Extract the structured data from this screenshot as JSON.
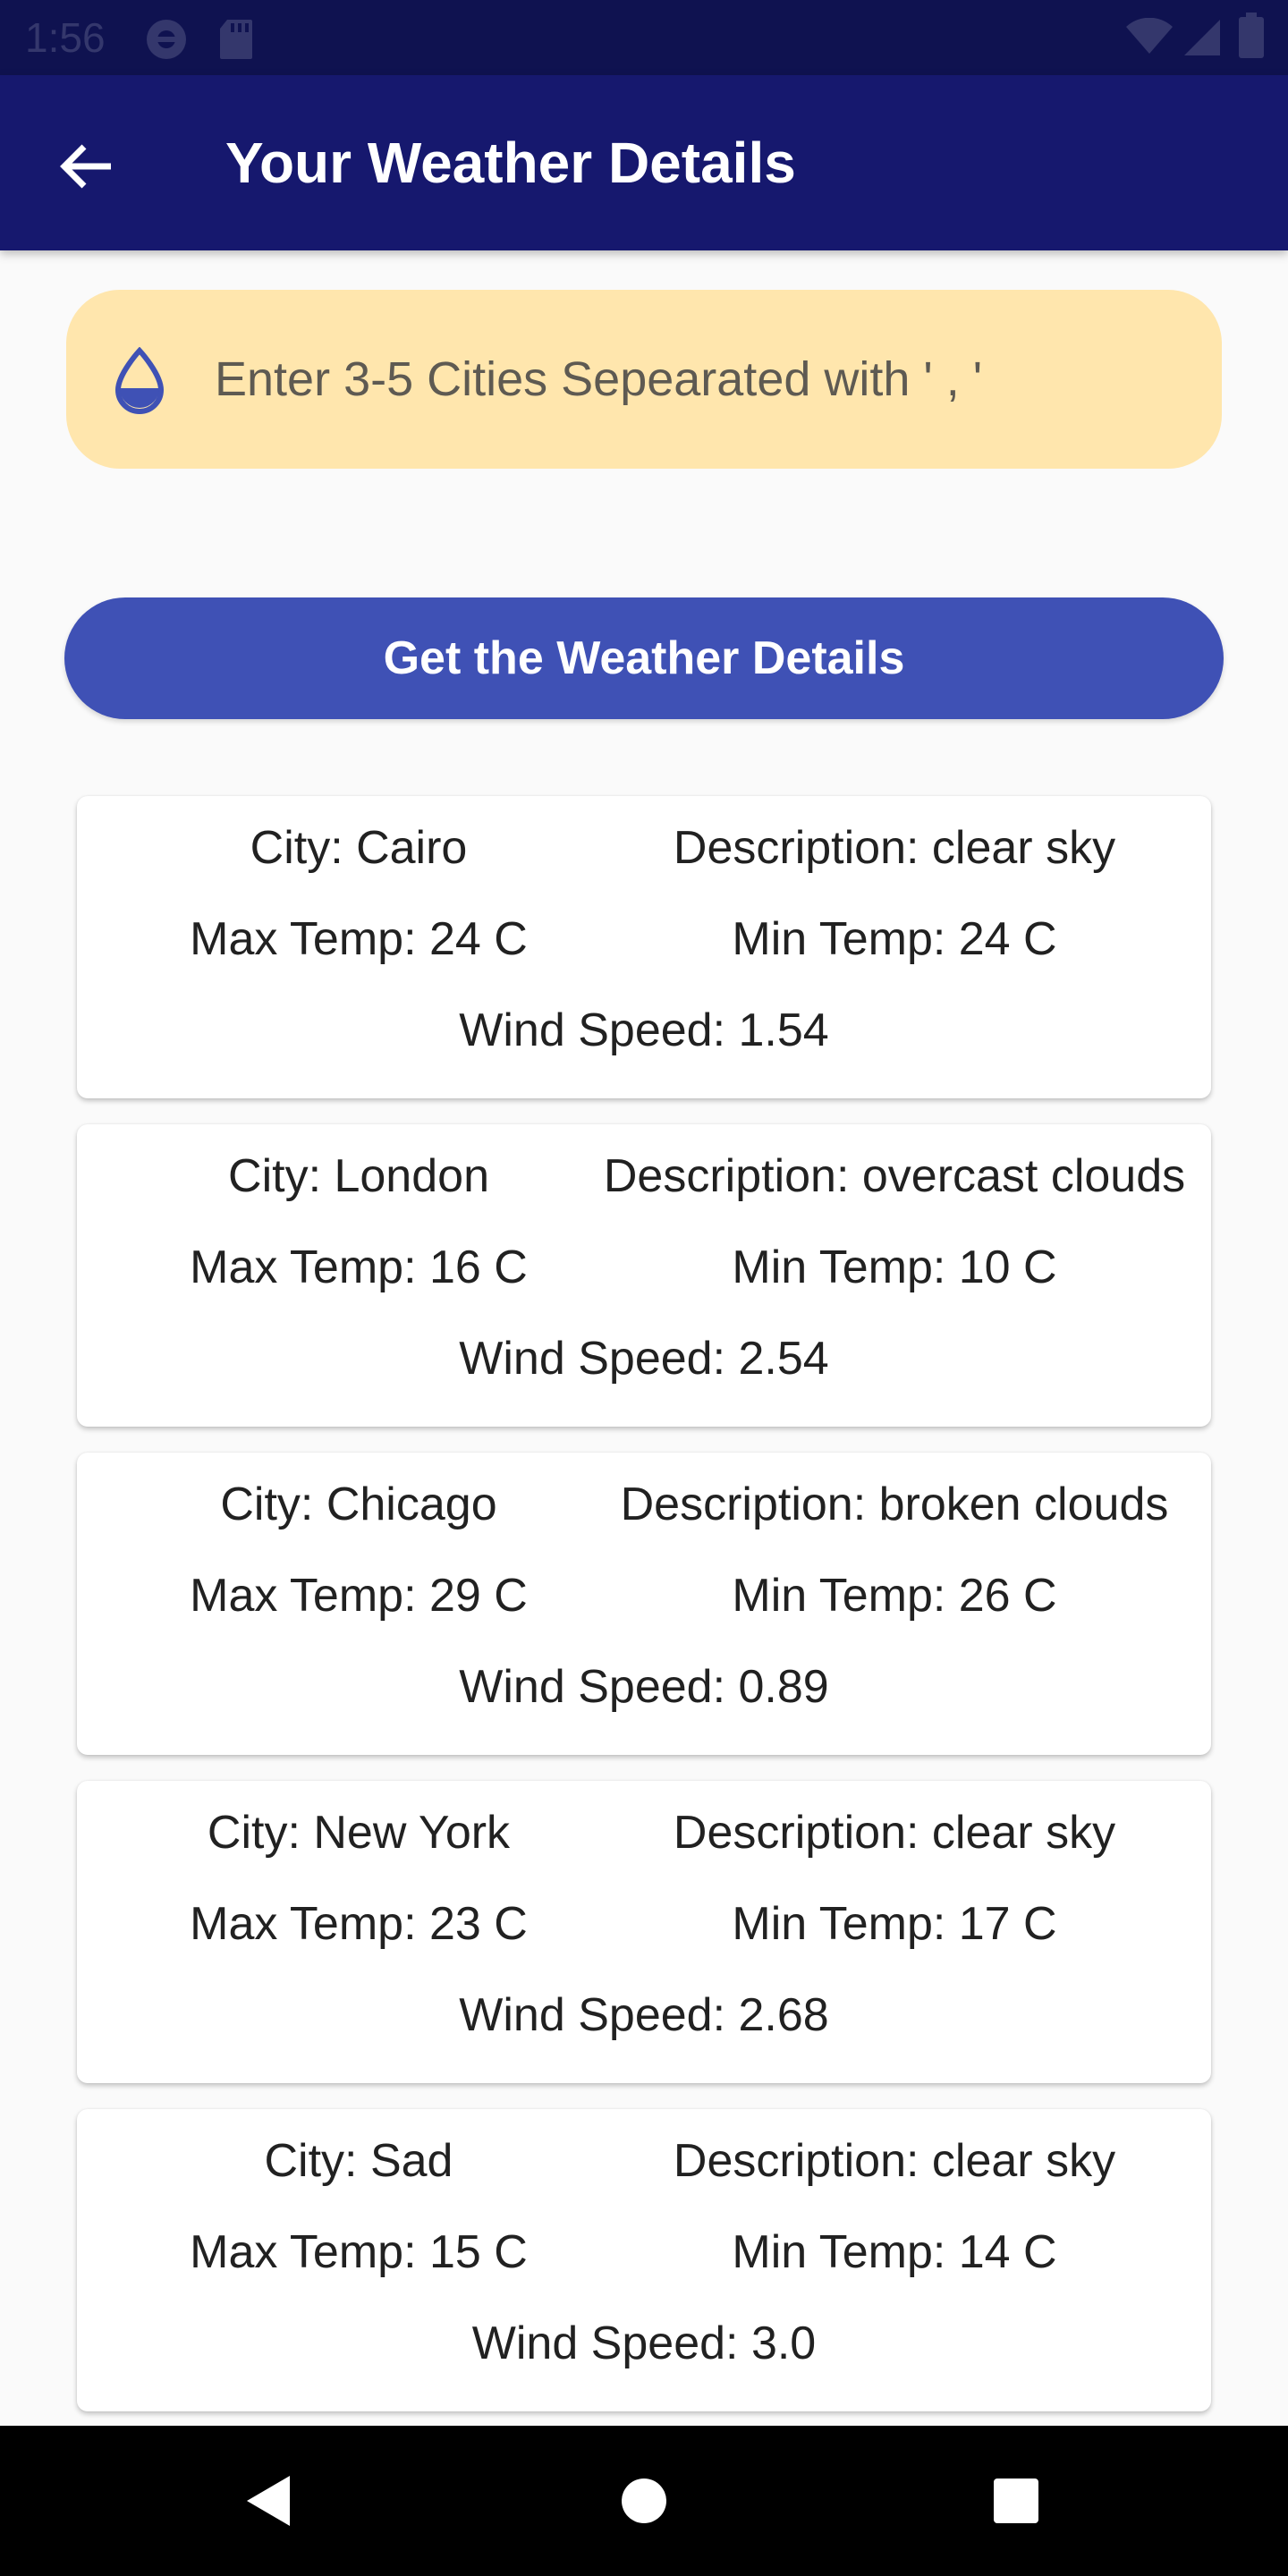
{
  "status_bar": {
    "time": "1:56",
    "icons": [
      "do-not-disturb-icon",
      "sd-card-icon",
      "wifi-icon",
      "cell-signal-icon",
      "battery-icon"
    ]
  },
  "app_bar": {
    "title": "Your Weather Details",
    "back_icon": "arrow-left-icon"
  },
  "city_input": {
    "icon": "water-drop-icon",
    "placeholder": "Enter 3-5 Cities Sepearated with ' , '",
    "value": ""
  },
  "get_button": {
    "label": "Get the Weather Details"
  },
  "weather_cards": [
    {
      "city": "City: Cairo",
      "description": "Description: clear sky",
      "max_temp": "Max Temp: 24 C",
      "min_temp": "Min Temp: 24 C",
      "wind_speed": "Wind Speed: 1.54"
    },
    {
      "city": "City: London",
      "description": "Description: overcast clouds",
      "max_temp": "Max Temp: 16 C",
      "min_temp": "Min Temp: 10 C",
      "wind_speed": "Wind Speed: 2.54"
    },
    {
      "city": "City: Chicago",
      "description": "Description: broken clouds",
      "max_temp": "Max Temp: 29 C",
      "min_temp": "Min Temp: 26 C",
      "wind_speed": "Wind Speed: 0.89"
    },
    {
      "city": "City: New York",
      "description": "Description: clear sky",
      "max_temp": "Max Temp: 23 C",
      "min_temp": "Min Temp: 17 C",
      "wind_speed": "Wind Speed: 2.68"
    },
    {
      "city": "City: Sad",
      "description": "Description: clear sky",
      "max_temp": "Max Temp: 15 C",
      "min_temp": "Min Temp: 14 C",
      "wind_speed": "Wind Speed: 3.0"
    }
  ],
  "nav_bar": {
    "icons": [
      "nav-back-icon",
      "nav-home-icon",
      "nav-recents-icon"
    ]
  },
  "colors": {
    "status_bar": "#0f1250",
    "app_bar": "#16186e",
    "input_background": "#ffe6ad",
    "button": "#3f51b5",
    "accent_icon": "#3f51b5",
    "page_background": "#fafafa",
    "card_background": "#ffffff"
  }
}
